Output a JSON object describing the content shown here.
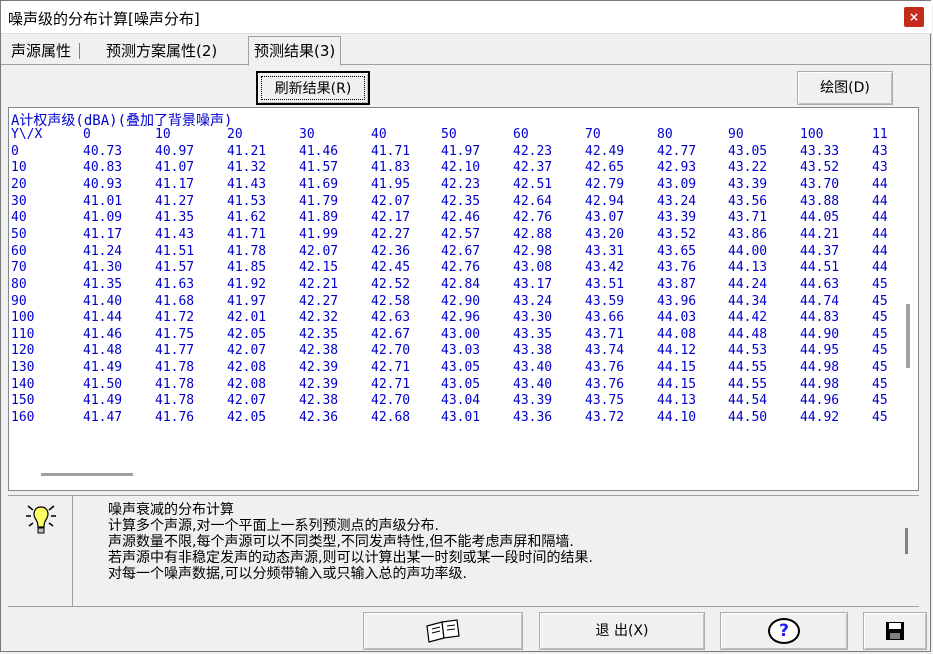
{
  "window": {
    "title": "噪声级的分布计算[噪声分布]",
    "close_glyph": "×"
  },
  "tabs": [
    {
      "label": "声源属性"
    },
    {
      "label": "预测方案属性(2)"
    },
    {
      "label": "预测结果(3)"
    }
  ],
  "toolbar": {
    "refresh_label": "刷新结果(R)",
    "draw_label": "绘图(D)"
  },
  "results": {
    "heading": "A计权声级(dBA)(叠加了背景噪声)",
    "corner": "Y\\/X",
    "columns": [
      "0",
      "10",
      "20",
      "30",
      "40",
      "50",
      "60",
      "70",
      "80",
      "90",
      "100",
      "11"
    ],
    "rows": [
      {
        "y": "0",
        "v": [
          "40.73",
          "40.97",
          "41.21",
          "41.46",
          "41.71",
          "41.97",
          "42.23",
          "42.49",
          "42.77",
          "43.05",
          "43.33",
          "43"
        ]
      },
      {
        "y": "10",
        "v": [
          "40.83",
          "41.07",
          "41.32",
          "41.57",
          "41.83",
          "42.10",
          "42.37",
          "42.65",
          "42.93",
          "43.22",
          "43.52",
          "43"
        ]
      },
      {
        "y": "20",
        "v": [
          "40.93",
          "41.17",
          "41.43",
          "41.69",
          "41.95",
          "42.23",
          "42.51",
          "42.79",
          "43.09",
          "43.39",
          "43.70",
          "44"
        ]
      },
      {
        "y": "30",
        "v": [
          "41.01",
          "41.27",
          "41.53",
          "41.79",
          "42.07",
          "42.35",
          "42.64",
          "42.94",
          "43.24",
          "43.56",
          "43.88",
          "44"
        ]
      },
      {
        "y": "40",
        "v": [
          "41.09",
          "41.35",
          "41.62",
          "41.89",
          "42.17",
          "42.46",
          "42.76",
          "43.07",
          "43.39",
          "43.71",
          "44.05",
          "44"
        ]
      },
      {
        "y": "50",
        "v": [
          "41.17",
          "41.43",
          "41.71",
          "41.99",
          "42.27",
          "42.57",
          "42.88",
          "43.20",
          "43.52",
          "43.86",
          "44.21",
          "44"
        ]
      },
      {
        "y": "60",
        "v": [
          "41.24",
          "41.51",
          "41.78",
          "42.07",
          "42.36",
          "42.67",
          "42.98",
          "43.31",
          "43.65",
          "44.00",
          "44.37",
          "44"
        ]
      },
      {
        "y": "70",
        "v": [
          "41.30",
          "41.57",
          "41.85",
          "42.15",
          "42.45",
          "42.76",
          "43.08",
          "43.42",
          "43.76",
          "44.13",
          "44.51",
          "44"
        ]
      },
      {
        "y": "80",
        "v": [
          "41.35",
          "41.63",
          "41.92",
          "42.21",
          "42.52",
          "42.84",
          "43.17",
          "43.51",
          "43.87",
          "44.24",
          "44.63",
          "45"
        ]
      },
      {
        "y": "90",
        "v": [
          "41.40",
          "41.68",
          "41.97",
          "42.27",
          "42.58",
          "42.90",
          "43.24",
          "43.59",
          "43.96",
          "44.34",
          "44.74",
          "45"
        ]
      },
      {
        "y": "100",
        "v": [
          "41.44",
          "41.72",
          "42.01",
          "42.32",
          "42.63",
          "42.96",
          "43.30",
          "43.66",
          "44.03",
          "44.42",
          "44.83",
          "45"
        ]
      },
      {
        "y": "110",
        "v": [
          "41.46",
          "41.75",
          "42.05",
          "42.35",
          "42.67",
          "43.00",
          "43.35",
          "43.71",
          "44.08",
          "44.48",
          "44.90",
          "45"
        ]
      },
      {
        "y": "120",
        "v": [
          "41.48",
          "41.77",
          "42.07",
          "42.38",
          "42.70",
          "43.03",
          "43.38",
          "43.74",
          "44.12",
          "44.53",
          "44.95",
          "45"
        ]
      },
      {
        "y": "130",
        "v": [
          "41.49",
          "41.78",
          "42.08",
          "42.39",
          "42.71",
          "43.05",
          "43.40",
          "43.76",
          "44.15",
          "44.55",
          "44.98",
          "45"
        ]
      },
      {
        "y": "140",
        "v": [
          "41.50",
          "41.78",
          "42.08",
          "42.39",
          "42.71",
          "43.05",
          "43.40",
          "43.76",
          "44.15",
          "44.55",
          "44.98",
          "45"
        ]
      },
      {
        "y": "150",
        "v": [
          "41.49",
          "41.78",
          "42.07",
          "42.38",
          "42.70",
          "43.04",
          "43.39",
          "43.75",
          "44.13",
          "44.54",
          "44.96",
          "45"
        ]
      },
      {
        "y": "160",
        "v": [
          "41.47",
          "41.76",
          "42.05",
          "42.36",
          "42.68",
          "43.01",
          "43.36",
          "43.72",
          "44.10",
          "44.50",
          "44.92",
          "45"
        ]
      }
    ]
  },
  "info": {
    "icon": "lightbulb-icon",
    "lines": [
      "噪声衰减的分布计算",
      "计算多个声源,对一个平面上一系列预测点的声级分布.",
      "声源数量不限,每个声源可以不同类型,不同发声特性,但不能考虑声屏和隔墙.",
      "若声源中有非稳定发声的动态声源,则可以计算出某一时刻或某一段时间的结果.",
      "对每一个噪声数据,可以分频带输入或只输入总的声功率级."
    ]
  },
  "footer": {
    "book_icon": "book-icon",
    "exit_label": "退 出(X)",
    "help_glyph": "?",
    "save_icon": "floppy-disk-icon"
  }
}
